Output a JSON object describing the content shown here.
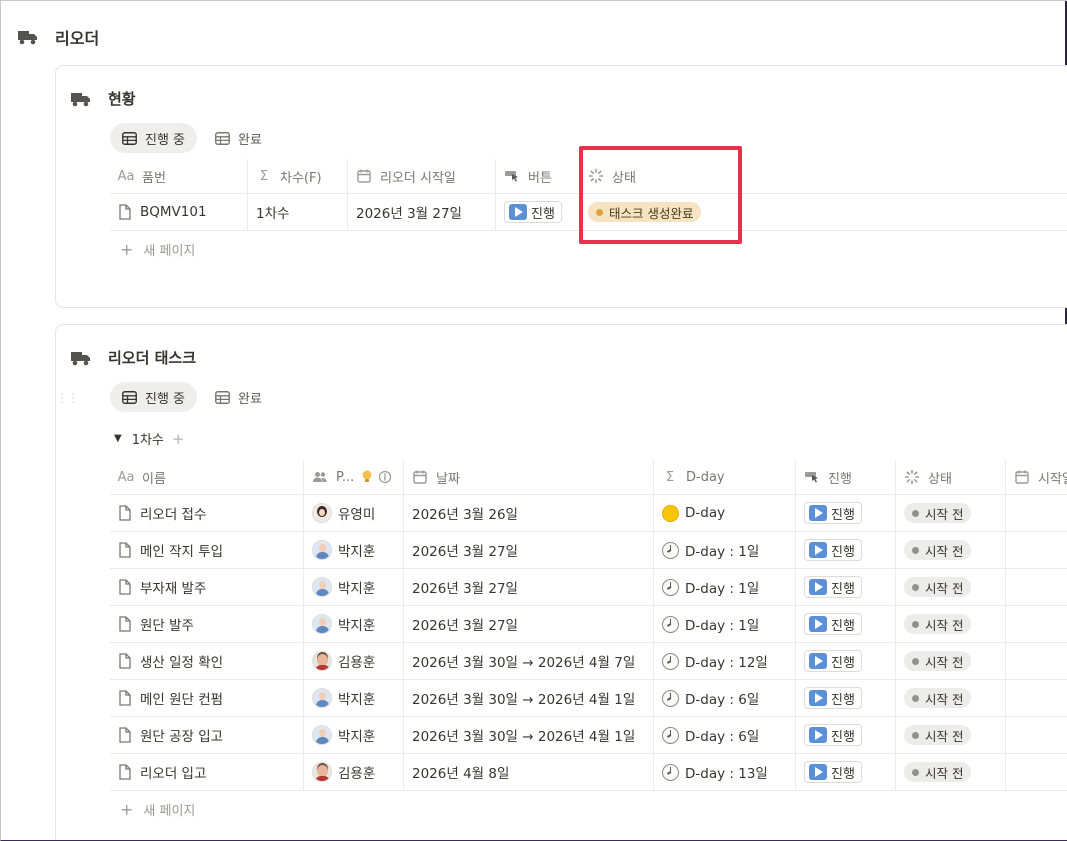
{
  "page": {
    "title": "리오더"
  },
  "status_card": {
    "title": "현황",
    "tabs": [
      {
        "label": "진행 중"
      },
      {
        "label": "완료"
      }
    ],
    "columns": [
      {
        "icon": "Aa",
        "label": "품번"
      },
      {
        "icon": "Σ",
        "label": "차수(F)"
      },
      {
        "label": "리오더 시작일"
      },
      {
        "label": "버튼"
      },
      {
        "label": "상태"
      }
    ],
    "rows": [
      {
        "part_no": "BQMV101",
        "round": "1차수",
        "start": "2026년 3월 27일",
        "button": "진행",
        "status": "태스크 생성완료"
      }
    ],
    "new_page": "새 페이지"
  },
  "task_card": {
    "title": "리오더 태스크",
    "tabs": [
      {
        "label": "진행 중"
      },
      {
        "label": "완료"
      }
    ],
    "group": {
      "label": "1차수"
    },
    "columns": [
      {
        "icon": "Aa",
        "label": "이름"
      },
      {
        "label": "P..."
      },
      {
        "label": "날짜"
      },
      {
        "icon": "Σ",
        "label": "D-day"
      },
      {
        "label": "진행"
      },
      {
        "label": "상태"
      },
      {
        "label": "시작일"
      }
    ],
    "rows": [
      {
        "name": "리오더 접수",
        "person": "유영미",
        "avatar": "f",
        "date": "2026년 3월 26일",
        "dday": "D-day",
        "dday_icon": "sun",
        "button": "진행",
        "status": "시작 전"
      },
      {
        "name": "메인 작지 투입",
        "person": "박지훈",
        "avatar": "m1",
        "date": "2026년 3월 27일",
        "dday": "D-day : 1일",
        "dday_icon": "clock",
        "button": "진행",
        "status": "시작 전"
      },
      {
        "name": "부자재 발주",
        "person": "박지훈",
        "avatar": "m1",
        "date": "2026년 3월 27일",
        "dday": "D-day : 1일",
        "dday_icon": "clock",
        "button": "진행",
        "status": "시작 전"
      },
      {
        "name": "원단 발주",
        "person": "박지훈",
        "avatar": "m1",
        "date": "2026년 3월 27일",
        "dday": "D-day : 1일",
        "dday_icon": "clock",
        "button": "진행",
        "status": "시작 전"
      },
      {
        "name": "생산 일정 확인",
        "person": "김용훈",
        "avatar": "m2",
        "date": "2026년 3월 30일 → 2026년 4월 7일",
        "dday": "D-day : 12일",
        "dday_icon": "clock",
        "button": "진행",
        "status": "시작 전"
      },
      {
        "name": "메인 원단 컨펌",
        "person": "박지훈",
        "avatar": "m1",
        "date": "2026년 3월 30일 → 2026년 4월 1일",
        "dday": "D-day : 6일",
        "dday_icon": "clock",
        "button": "진행",
        "status": "시작 전"
      },
      {
        "name": "원단 공장 입고",
        "person": "박지훈",
        "avatar": "m1",
        "date": "2026년 3월 30일 → 2026년 4월 1일",
        "dday": "D-day : 6일",
        "dday_icon": "clock",
        "button": "진행",
        "status": "시작 전"
      },
      {
        "name": "리오더 입고",
        "person": "김용훈",
        "avatar": "m2",
        "date": "2026년 4월 8일",
        "dday": "D-day : 13일",
        "dday_icon": "clock",
        "button": "진행",
        "status": "시작 전"
      }
    ],
    "new_page": "새 페이지"
  },
  "colors": {
    "highlight": "#e8324a",
    "done_pill": "#f5e3c2",
    "todo_pill": "#ececeb",
    "play_button": "#5b8fd6"
  }
}
